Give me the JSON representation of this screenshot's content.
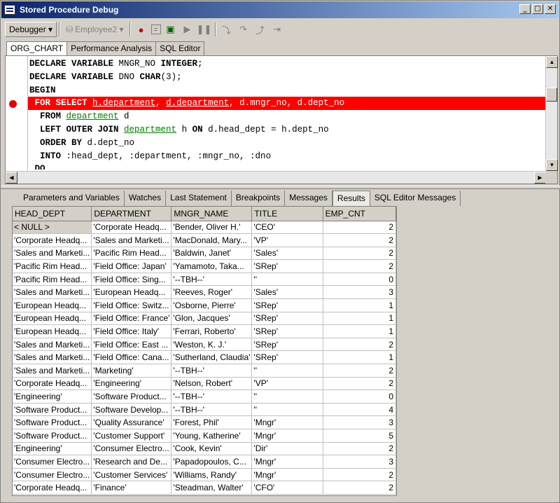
{
  "window": {
    "title": "Stored Procedure Debug",
    "min": "_",
    "max": "□",
    "close": "✕"
  },
  "toolbar": {
    "debugger_label": "Debugger ▾",
    "employee_label": "Employee2 ▾"
  },
  "doc_tabs": [
    "ORG_CHART",
    "Performance Analysis",
    "SQL Editor"
  ],
  "code_lines": [
    [
      {
        "t": "DECLARE VARIABLE",
        "c": "kw"
      },
      {
        "t": " MNGR_NO ",
        "c": ""
      },
      {
        "t": "INTEGER",
        "c": "kw"
      },
      {
        "t": ";",
        "c": ""
      }
    ],
    [
      {
        "t": "DECLARE VARIABLE",
        "c": "kw"
      },
      {
        "t": " DNO ",
        "c": ""
      },
      {
        "t": "CHAR",
        "c": "kw"
      },
      {
        "t": "(3);",
        "c": ""
      }
    ],
    [
      {
        "t": "BEGIN",
        "c": "kw"
      }
    ],
    [
      {
        "t": " FOR SELECT",
        "c": "kw"
      },
      {
        "t": " ",
        "c": ""
      },
      {
        "t": "h.department",
        "c": "ul"
      },
      {
        "t": ", ",
        "c": ""
      },
      {
        "t": "d.department",
        "c": "ul"
      },
      {
        "t": ", d.mngr_no, d.dept_no",
        "c": ""
      }
    ],
    [
      {
        "t": "  FROM",
        "c": "kw"
      },
      {
        "t": " ",
        "c": ""
      },
      {
        "t": "department",
        "c": "tbl"
      },
      {
        "t": " d",
        "c": ""
      }
    ],
    [
      {
        "t": "  LEFT OUTER JOIN",
        "c": "kw"
      },
      {
        "t": " ",
        "c": ""
      },
      {
        "t": "department",
        "c": "tbl"
      },
      {
        "t": " h ",
        "c": ""
      },
      {
        "t": "ON",
        "c": "kw"
      },
      {
        "t": " d.head_dept = h.dept_no",
        "c": ""
      }
    ],
    [
      {
        "t": "  ORDER BY",
        "c": "kw"
      },
      {
        "t": " d.dept_no",
        "c": ""
      }
    ],
    [
      {
        "t": "  INTO",
        "c": "kw"
      },
      {
        "t": " :head_dept, :department, :mngr_no, :dno",
        "c": ""
      }
    ],
    [
      {
        "t": " DO",
        "c": "kw"
      }
    ]
  ],
  "highlight_line": 3,
  "bottom_tabs": [
    {
      "label": "Parameters and Variables"
    },
    {
      "label": "Watches"
    },
    {
      "label": "Last Statement"
    },
    {
      "label": "Breakpoints"
    },
    {
      "label": "Messages"
    },
    {
      "label": "Results"
    },
    {
      "label": "SQL Editor Messages"
    }
  ],
  "grid": {
    "columns": [
      "HEAD_DEPT",
      "DEPARTMENT",
      "MNGR_NAME",
      "TITLE",
      "EMP_CNT"
    ],
    "rows": [
      [
        "< NULL >",
        "'Corporate Headq...",
        "'Bender, Oliver H.'",
        "'CEO'",
        "2"
      ],
      [
        "'Corporate Headq...",
        "'Sales and Marketi...",
        "'MacDonald, Mary...",
        "'VP'",
        "2"
      ],
      [
        "'Sales and Marketi...",
        "'Pacific Rim Head...",
        "'Baldwin, Janet'",
        "'Sales'",
        "2"
      ],
      [
        "'Pacific Rim Head...",
        "'Field Office: Japan'",
        "'Yamamoto, Taka...",
        "'SRep'",
        "2"
      ],
      [
        "'Pacific Rim Head...",
        "'Field Office: Sing...",
        "'--TBH--'",
        "''",
        "0"
      ],
      [
        "'Sales and Marketi...",
        "'European Headq...",
        "'Reeves, Roger'",
        "'Sales'",
        "3"
      ],
      [
        "'European Headq...",
        "'Field Office: Switz...",
        "'Osborne, Pierre'",
        "'SRep'",
        "1"
      ],
      [
        "'European Headq...",
        "'Field Office: France'",
        "'Glon, Jacques'",
        "'SRep'",
        "1"
      ],
      [
        "'European Headq...",
        "'Field Office: Italy'",
        "'Ferrari, Roberto'",
        "'SRep'",
        "1"
      ],
      [
        "'Sales and Marketi...",
        "'Field Office: East ...",
        "'Weston, K. J.'",
        "'SRep'",
        "2"
      ],
      [
        "'Sales and Marketi...",
        "'Field Office: Cana...",
        "'Sutherland, Claudia'",
        "'SRep'",
        "1"
      ],
      [
        "'Sales and Marketi...",
        "'Marketing'",
        "'--TBH--'",
        "''",
        "2"
      ],
      [
        "'Corporate Headq...",
        "'Engineering'",
        "'Nelson, Robert'",
        "'VP'",
        "2"
      ],
      [
        "'Engineering'",
        "'Software Product...",
        "'--TBH--'",
        "''",
        "0"
      ],
      [
        "'Software Product...",
        "'Software Develop...",
        "'--TBH--'",
        "''",
        "4"
      ],
      [
        "'Software Product...",
        "'Quality Assurance'",
        "'Forest, Phil'",
        "'Mngr'",
        "3"
      ],
      [
        "'Software Product...",
        "'Customer Support'",
        "'Young, Katherine'",
        "'Mngr'",
        "5"
      ],
      [
        "'Engineering'",
        "'Consumer Electro...",
        "'Cook, Kevin'",
        "'Dir'",
        "2"
      ],
      [
        "'Consumer Electro...",
        "'Research and De...",
        "'Papadopoulos, C...",
        "'Mngr'",
        "3"
      ],
      [
        "'Consumer Electro...",
        "'Customer Services'",
        "'Williams, Randy'",
        "'Mngr'",
        "2"
      ],
      [
        "'Corporate Headq...",
        "'Finance'",
        "'Steadman, Walter'",
        "'CFO'",
        "2"
      ]
    ]
  },
  "colors": {
    "highlight": "#ff0000",
    "table_name": "#008000",
    "title_start": "#0a246a",
    "title_end": "#a6caf0"
  }
}
